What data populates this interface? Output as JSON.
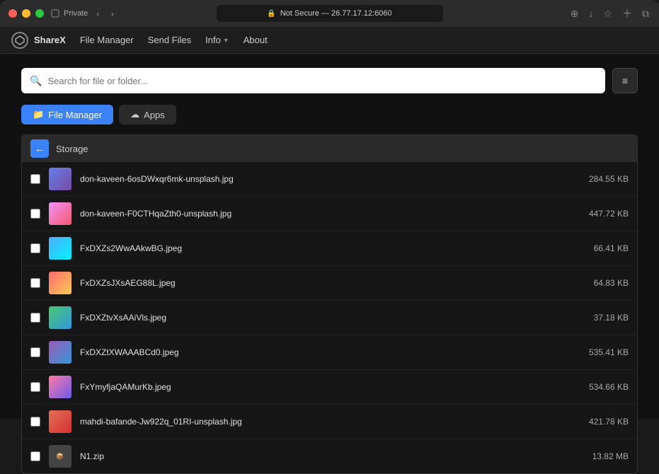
{
  "titlebar": {
    "traffic_lights": [
      "red",
      "yellow",
      "green"
    ],
    "private_label": "Private",
    "url": "Not Secure — 26.77.17.12:6060",
    "nav_back": "‹",
    "nav_forward": "›"
  },
  "menubar": {
    "app_name": "ShareX",
    "app_logo_text": "⬡",
    "items": [
      {
        "label": "File Manager",
        "id": "file-manager"
      },
      {
        "label": "Send Files",
        "id": "send-files"
      },
      {
        "label": "Info",
        "id": "info",
        "has_dropdown": true
      },
      {
        "label": "About",
        "id": "about"
      }
    ]
  },
  "search": {
    "placeholder": "Search for file or folder...",
    "hamburger_icon": "≡"
  },
  "tabs": [
    {
      "label": "File Manager",
      "icon": "📁",
      "active": true
    },
    {
      "label": "Apps",
      "icon": "☁",
      "active": false
    }
  ],
  "file_list": {
    "storage_label": "Storage",
    "back_arrow": "←",
    "files": [
      {
        "name": "don-kaveen-6osDWxqr6mk-unsplash.jpg",
        "size": "284.55 KB",
        "thumb_class": "thumb-1"
      },
      {
        "name": "don-kaveen-F0CTHqaZth0-unsplash.jpg",
        "size": "447.72 KB",
        "thumb_class": "thumb-2"
      },
      {
        "name": "FxDXZs2WwAAkwBG.jpeg",
        "size": "66.41 KB",
        "thumb_class": "thumb-3"
      },
      {
        "name": "FxDXZsJXsAEG88L.jpeg",
        "size": "64.83 KB",
        "thumb_class": "thumb-4"
      },
      {
        "name": "FxDXZtvXsAAiVls.jpeg",
        "size": "37.18 KB",
        "thumb_class": "thumb-5"
      },
      {
        "name": "FxDXZtXWAAABCd0.jpeg",
        "size": "535.41 KB",
        "thumb_class": "thumb-6"
      },
      {
        "name": "FxYmyfjaQAMurKb.jpeg",
        "size": "534.66 KB",
        "thumb_class": "thumb-7"
      },
      {
        "name": "mahdi-bafande-Jw922q_01RI-unsplash.jpg",
        "size": "421.78 KB",
        "thumb_class": "thumb-8"
      },
      {
        "name": "N1.zip",
        "size": "13.82 MB",
        "thumb_class": "thumb-9",
        "is_zip": true
      }
    ]
  }
}
